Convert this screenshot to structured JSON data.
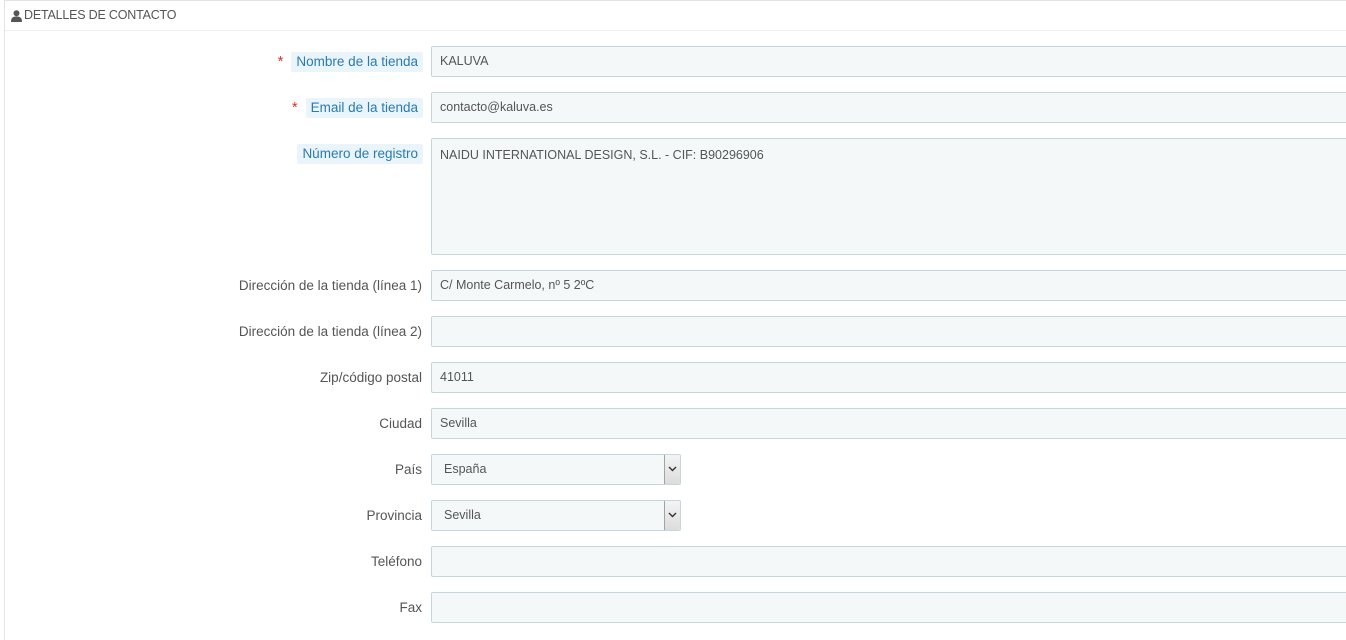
{
  "panel": {
    "title": "DETALLES DE CONTACTO",
    "icon": "user-icon"
  },
  "fields": {
    "shop_name": {
      "label": "Nombre de la tienda",
      "required": "*",
      "value": "KALUVA"
    },
    "shop_email": {
      "label": "Email de la tienda",
      "required": "*",
      "value": "contacto@kaluva.es"
    },
    "registration": {
      "label": "Número de registro",
      "value": "NAIDU INTERNATIONAL DESIGN, S.L. - CIF: B90296906"
    },
    "address1": {
      "label": "Dirección de la tienda (línea 1)",
      "value": "C/ Monte Carmelo, nº 5 2ºC"
    },
    "address2": {
      "label": "Dirección de la tienda (línea 2)",
      "value": ""
    },
    "zip": {
      "label": "Zip/código postal",
      "value": "41011"
    },
    "city": {
      "label": "Ciudad",
      "value": "Sevilla"
    },
    "country": {
      "label": "País",
      "selected": "España"
    },
    "state": {
      "label": "Provincia",
      "selected": "Sevilla"
    },
    "phone": {
      "label": "Teléfono",
      "value": ""
    },
    "fax": {
      "label": "Fax",
      "value": ""
    }
  },
  "colors": {
    "required": "#e0312d",
    "hint_text": "#2a7ab0",
    "hint_background": "#eaf5fb",
    "input_background": "#f5f8f9",
    "input_border": "#c7d6db"
  }
}
